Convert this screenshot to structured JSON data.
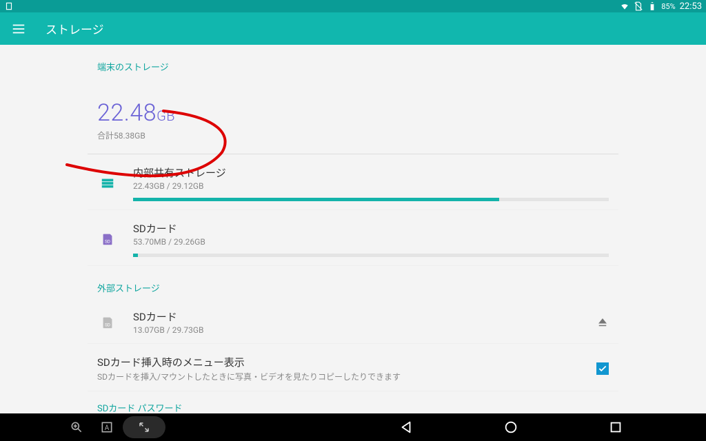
{
  "statusbar": {
    "battery": "85%",
    "time": "22:53"
  },
  "appbar": {
    "title": "ストレージ"
  },
  "section_device": "端末のストレージ",
  "used": {
    "value": "22.48",
    "unit": "GB"
  },
  "total": "合計58.38GB",
  "internal": {
    "title": "内部共有ストレージ",
    "sub": "22.43GB / 29.12GB",
    "pct": 77
  },
  "portable_sd": {
    "title": "SDカード",
    "sub": "53.70MB / 29.26GB",
    "pct": 1
  },
  "section_external": "外部ストレージ",
  "external_sd": {
    "title": "SDカード",
    "sub": "13.07GB / 29.73GB"
  },
  "menu_row": {
    "title": "SDカード挿入時のメニュー表示",
    "sub": "SDカードを挿入/マウントしたときに写真・ビデオを見たりコピーしたりできます"
  },
  "sd_password": "SDカード パスワード"
}
